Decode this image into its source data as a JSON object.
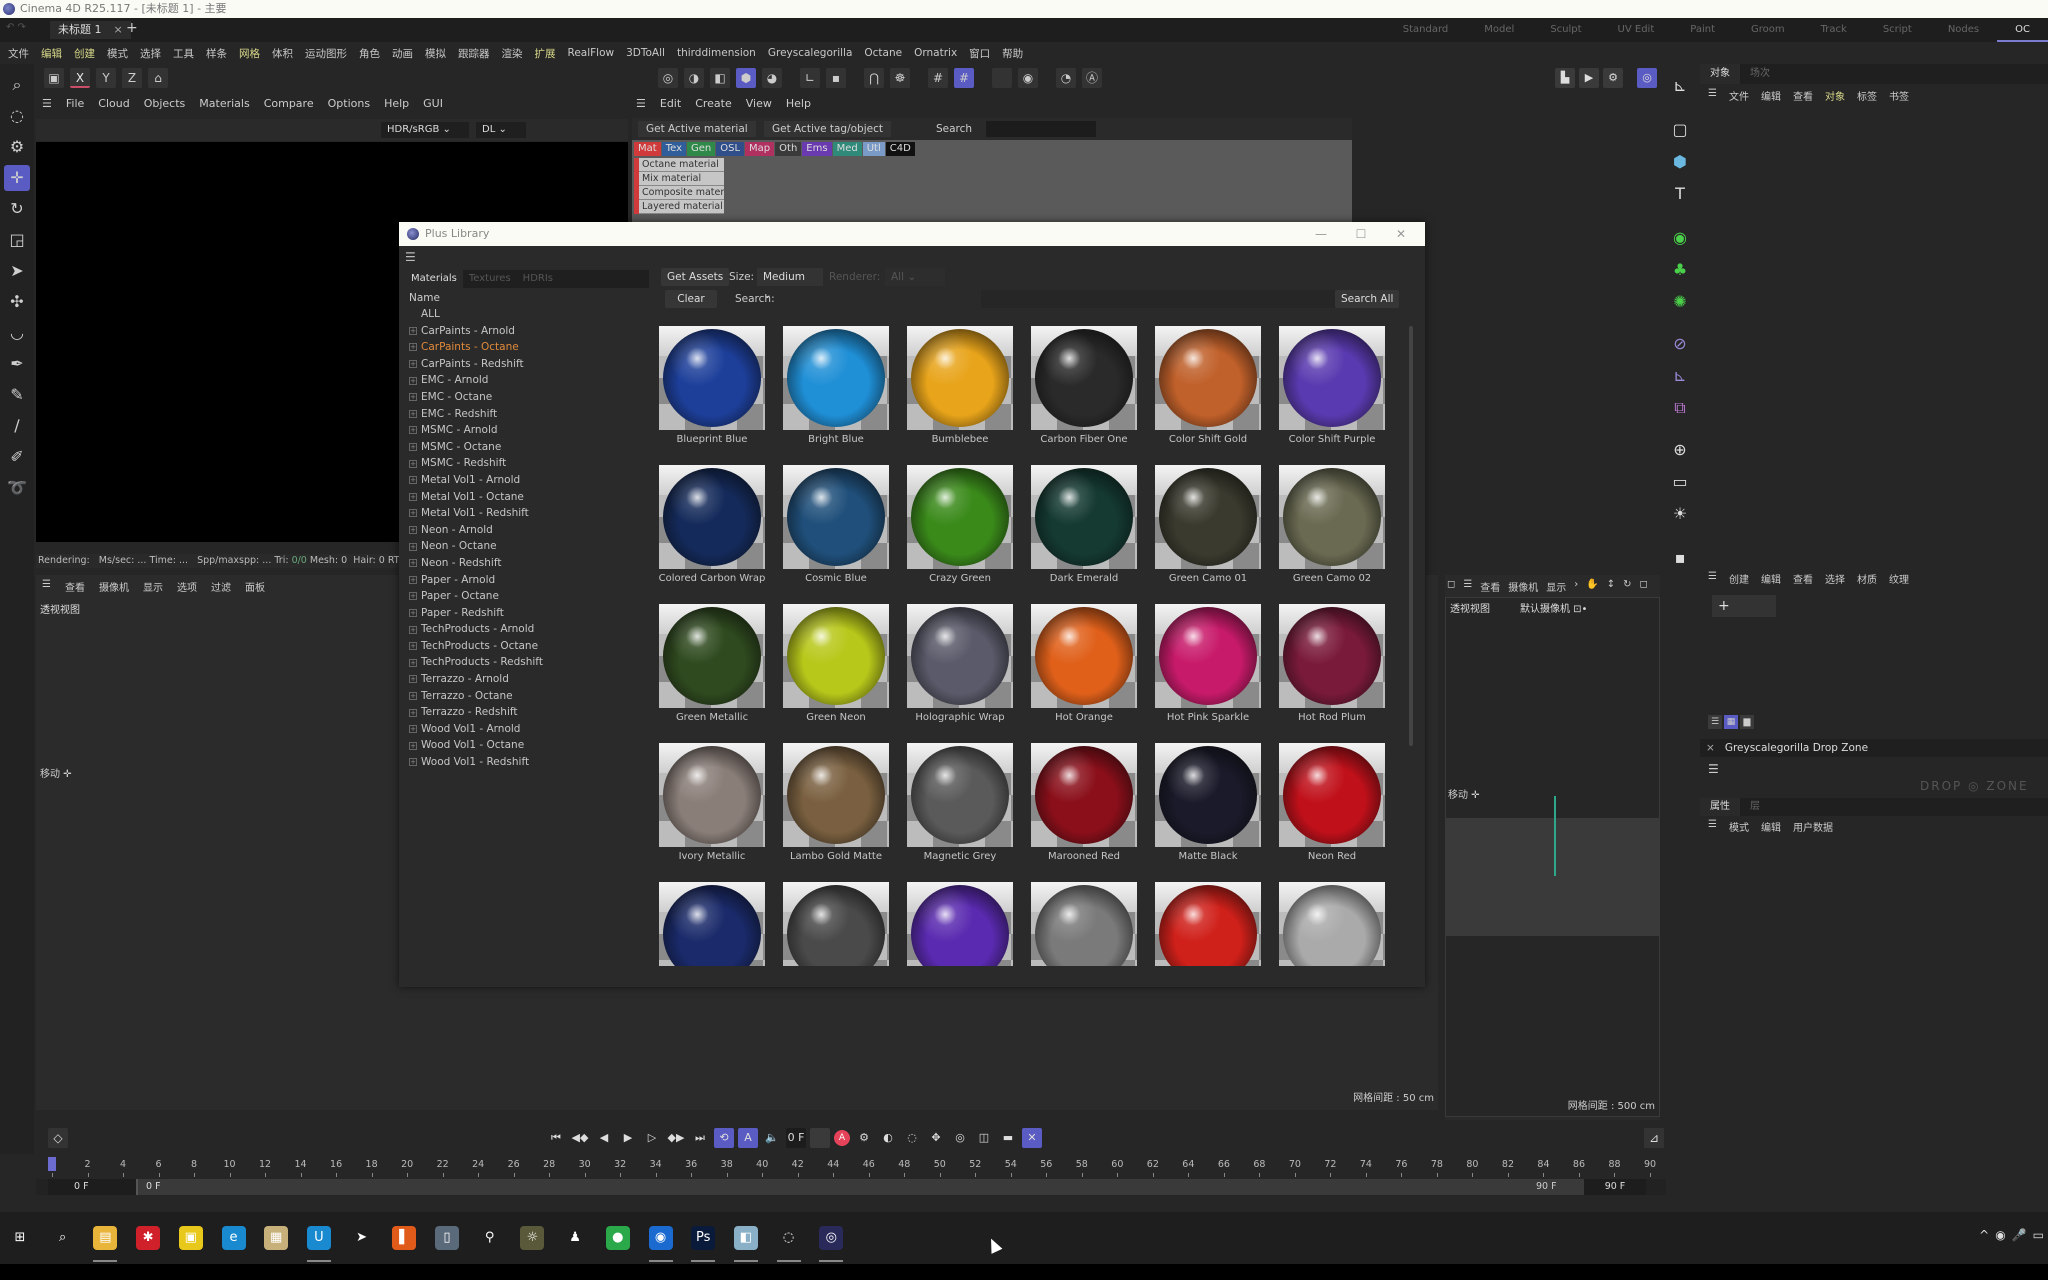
{
  "window": {
    "title": "Cinema 4D R25.117 - [未标题 1] - 主要"
  },
  "doc_tab": {
    "label": "未标题 1",
    "close": "×",
    "new": "+"
  },
  "layouts": [
    "Standard",
    "Model",
    "Sculpt",
    "UV Edit",
    "Paint",
    "Groom",
    "Track",
    "Script",
    "Nodes",
    "OC"
  ],
  "menubar": [
    "文件",
    "编辑",
    "创建",
    "模式",
    "选择",
    "工具",
    "样条",
    "网格",
    "体积",
    "运动图形",
    "角色",
    "动画",
    "模拟",
    "跟踪器",
    "渲染",
    "扩展",
    "RealFlow",
    "3DToAll",
    "thirddimension",
    "Greyscalegorilla",
    "Octane",
    "Ornatrix",
    "窗口",
    "帮助"
  ],
  "left_tools": [
    "search-icon",
    "live-selection-icon",
    "gear-cursor-icon",
    "move-icon",
    "rotate-icon",
    "scale-icon",
    "select-move-icon",
    "transform-icon",
    "spline-arc-icon",
    "pen-icon",
    "polygon-pen-icon",
    "brush-icon",
    "sketch-icon",
    "lasso-icon"
  ],
  "octane_viewer": {
    "toolbar": [
      "X",
      "Y",
      "Z",
      "⌂"
    ],
    "menu": [
      "File",
      "Cloud",
      "Objects",
      "Materials",
      "Compare",
      "Options",
      "Help",
      "GUI"
    ],
    "color_space": "HDR/sRGB",
    "kernel": "DL",
    "status": {
      "rendering": "Rendering:",
      "ms": "Ms/sec: ...",
      "time": "Time: ...",
      "spp": "Spp/maxspp: ...",
      "tri_label": "Tri:",
      "tri": "0/0",
      "mesh": "Mesh: 0",
      "hair": "Hair: 0",
      "rtx": "RTX:"
    }
  },
  "viewport_left": {
    "menu": [
      "查看",
      "摄像机",
      "显示",
      "选项",
      "过滤",
      "面板"
    ],
    "label": "透视视图",
    "move": "移动 ✛",
    "grid": "网格间距 : 50 cm"
  },
  "material_manager": {
    "menu": [
      "Edit",
      "Create",
      "View",
      "Help"
    ],
    "get_material": "Get Active material",
    "get_tag": "Get Active tag/object",
    "search_label": "Search",
    "tags": [
      {
        "label": "Mat",
        "color": "#d13a3a"
      },
      {
        "label": "Tex",
        "color": "#2f5e9a"
      },
      {
        "label": "Gen",
        "color": "#2f8a4a"
      },
      {
        "label": "OSL",
        "color": "#2f4e8a"
      },
      {
        "label": "Map",
        "color": "#b03060"
      },
      {
        "label": "Oth",
        "color": "#3a3a3a"
      },
      {
        "label": "Ems",
        "color": "#6a3ab0"
      },
      {
        "label": "Med",
        "color": "#2f8a7a"
      },
      {
        "label": "Utl",
        "color": "#7a9ac8"
      },
      {
        "label": "C4D",
        "color": "#111111"
      }
    ],
    "items": [
      "Octane material",
      "Mix material",
      "Composite material",
      "Layered material"
    ]
  },
  "plus_library": {
    "title": "Plus Library",
    "controls": {
      "minimize": "—",
      "maximize": "☐",
      "close": "✕"
    },
    "tabs": [
      "Materials",
      "Textures",
      "HDRIs"
    ],
    "tree_header": "Name",
    "tree": [
      "ALL",
      "CarPaints - Arnold",
      "CarPaints - Octane",
      "CarPaints - Redshift",
      "EMC - Arnold",
      "EMC - Octane",
      "EMC - Redshift",
      "MSMC - Arnold",
      "MSMC - Octane",
      "MSMC - Redshift",
      "Metal Vol1 - Arnold",
      "Metal Vol1 - Octane",
      "Metal Vol1 - Redshift",
      "Neon - Arnold",
      "Neon - Octane",
      "Neon - Redshift",
      "Paper - Arnold",
      "Paper - Octane",
      "Paper - Redshift",
      "TechProducts - Arnold",
      "TechProducts - Octane",
      "TechProducts - Redshift",
      "Terrazzo - Arnold",
      "Terrazzo - Octane",
      "Terrazzo - Redshift",
      "Wood Vol1 - Arnold",
      "Wood Vol1 - Octane",
      "Wood Vol1 - Redshift"
    ],
    "selected_tree": "CarPaints - Octane",
    "get_assets": "Get Assets",
    "size_label": "Size:",
    "size_value": "Medium",
    "renderer_label": "Renderer:",
    "renderer_value": "All",
    "clear": "Clear",
    "search_label": "Search:",
    "search_all": "Search All",
    "materials": [
      {
        "name": "Blueprint Blue",
        "color": "#1d3f9a"
      },
      {
        "name": "Bright Blue",
        "color": "#1f8fd6"
      },
      {
        "name": "Bumblebee",
        "color": "#e8a41a"
      },
      {
        "name": "Carbon Fiber One",
        "color": "#2a2a2a"
      },
      {
        "name": "Color Shift Gold",
        "color": "#c0602a"
      },
      {
        "name": "Color Shift Purple",
        "color": "#5a3ab0"
      },
      {
        "name": "Colored Carbon Wrap",
        "color": "#142a5a"
      },
      {
        "name": "Cosmic Blue",
        "color": "#1f4f7a"
      },
      {
        "name": "Crazy Green",
        "color": "#3a8a1a"
      },
      {
        "name": "Dark Emerald",
        "color": "#143a32"
      },
      {
        "name": "Green Camo 01",
        "color": "#3a3a2e"
      },
      {
        "name": "Green Camo 02",
        "color": "#6a6a52"
      },
      {
        "name": "Green Metallic",
        "color": "#2f4a1f"
      },
      {
        "name": "Green Neon",
        "color": "#b8c81a"
      },
      {
        "name": "Holographic Wrap",
        "color": "#5a5a6a"
      },
      {
        "name": "Hot Orange",
        "color": "#e0601a"
      },
      {
        "name": "Hot Pink Sparkle",
        "color": "#c81a6a"
      },
      {
        "name": "Hot Rod Plum",
        "color": "#7a1a3a"
      },
      {
        "name": "Ivory Metallic",
        "color": "#8a7e78"
      },
      {
        "name": "Lambo Gold Matte",
        "color": "#7a6040"
      },
      {
        "name": "Magnetic Grey",
        "color": "#5a5a5a"
      },
      {
        "name": "Marooned Red",
        "color": "#8a0f1a"
      },
      {
        "name": "Matte Black",
        "color": "#1a1a2a"
      },
      {
        "name": "Neon Red",
        "color": "#c0101a"
      },
      {
        "name": "",
        "color": "#1a2a6a"
      },
      {
        "name": "",
        "color": "#4a4a4a"
      },
      {
        "name": "",
        "color": "#5a2ab0"
      },
      {
        "name": "",
        "color": "#7a7a7a"
      },
      {
        "name": "",
        "color": "#d0201a"
      },
      {
        "name": "",
        "color": "#aaaaaa"
      }
    ]
  },
  "render_tools": [
    "render-view-icon",
    "render-picture-icon",
    "render-settings-icon",
    "octane-icon"
  ],
  "right_tools": [
    "axis-icon",
    "cube-outline-icon",
    "cube-icon",
    "text-icon",
    "subdivision-icon",
    "cloner-icon",
    "effector-icon",
    "deformer-icon",
    "field-icon",
    "mograph-icon",
    "environment-icon",
    "camera-icon",
    "light-icon",
    "tag-icon"
  ],
  "object_panel": {
    "tabs": [
      "对象",
      "场次"
    ],
    "menu": [
      "文件",
      "编辑",
      "查看",
      "对象",
      "标签",
      "书签"
    ],
    "highlight": "对象"
  },
  "viewport_right": {
    "menu": [
      "查看",
      "摄像机",
      "显示",
      "›"
    ],
    "label": "透视视图",
    "camera": "默认摄像机 ⊡•",
    "move": "移动 ✛",
    "grid": "网格间距 : 500 cm"
  },
  "mat_panel": {
    "menu": [
      "创建",
      "编辑",
      "查看",
      "选择",
      "材质",
      "纹理"
    ],
    "add": "+"
  },
  "drop_zone": {
    "close": "×",
    "title": "Greyscalegorilla Drop Zone",
    "logo": "DROP ◎ ZONE"
  },
  "attributes": {
    "tabs": [
      "属性",
      "层"
    ],
    "menu": [
      "模式",
      "编辑",
      "用户数据"
    ]
  },
  "timeline": {
    "current_frame": "0 F",
    "ticks": [
      0,
      2,
      4,
      6,
      8,
      10,
      12,
      14,
      16,
      18,
      20,
      22,
      24,
      26,
      28,
      30,
      32,
      34,
      36,
      38,
      40,
      42,
      44,
      46,
      48,
      50,
      52,
      54,
      56,
      58,
      60,
      62,
      64,
      66,
      68,
      70,
      72,
      74,
      76,
      78,
      80,
      82,
      84,
      86,
      88,
      90
    ],
    "range_start": "0 F",
    "range_min": "0 F",
    "range_max": "90 F",
    "range_end": "90 F"
  },
  "taskbar": {
    "apps": [
      {
        "name": "start",
        "glyph": "⊞",
        "color": "#1e1e1e"
      },
      {
        "name": "search",
        "glyph": "⌕",
        "color": "#1e1e1e"
      },
      {
        "name": "file-explorer",
        "glyph": "▤",
        "color": "#e8b43a"
      },
      {
        "name": "app-red",
        "glyph": "✱",
        "color": "#d0202a"
      },
      {
        "name": "sticky-notes",
        "glyph": "▣",
        "color": "#e8c81a"
      },
      {
        "name": "edge",
        "glyph": "e",
        "color": "#1a8ad0"
      },
      {
        "name": "photos",
        "glyph": "▦",
        "color": "#c8b07a"
      },
      {
        "name": "app-u",
        "glyph": "U",
        "color": "#1a8ad0"
      },
      {
        "name": "app-arrow",
        "glyph": "➤",
        "color": "#1e1e1e"
      },
      {
        "name": "app-colorful",
        "glyph": "▌",
        "color": "#e05a1a"
      },
      {
        "name": "app-trash",
        "glyph": "▯",
        "color": "#5a6a7a"
      },
      {
        "name": "app-search-orange",
        "glyph": "⚲",
        "color": "#1e1e1e"
      },
      {
        "name": "app-game",
        "glyph": "☼",
        "color": "#5a5a3a"
      },
      {
        "name": "app-figure",
        "glyph": "♟",
        "color": "#1e1e1e"
      },
      {
        "name": "wechat",
        "glyph": "●",
        "color": "#2aa84a"
      },
      {
        "name": "app-blue",
        "glyph": "◉",
        "color": "#1a6ad0"
      },
      {
        "name": "photoshop",
        "glyph": "Ps",
        "color": "#0a1a3a"
      },
      {
        "name": "app-doc",
        "glyph": "◧",
        "color": "#8ab0c8"
      },
      {
        "name": "cinema4d-a",
        "glyph": "◌",
        "color": "#1e1e1e"
      },
      {
        "name": "cinema4d-b",
        "glyph": "◎",
        "color": "#2a2a5a"
      }
    ],
    "tray": [
      "^",
      "◉",
      "🎤",
      "▭"
    ]
  }
}
